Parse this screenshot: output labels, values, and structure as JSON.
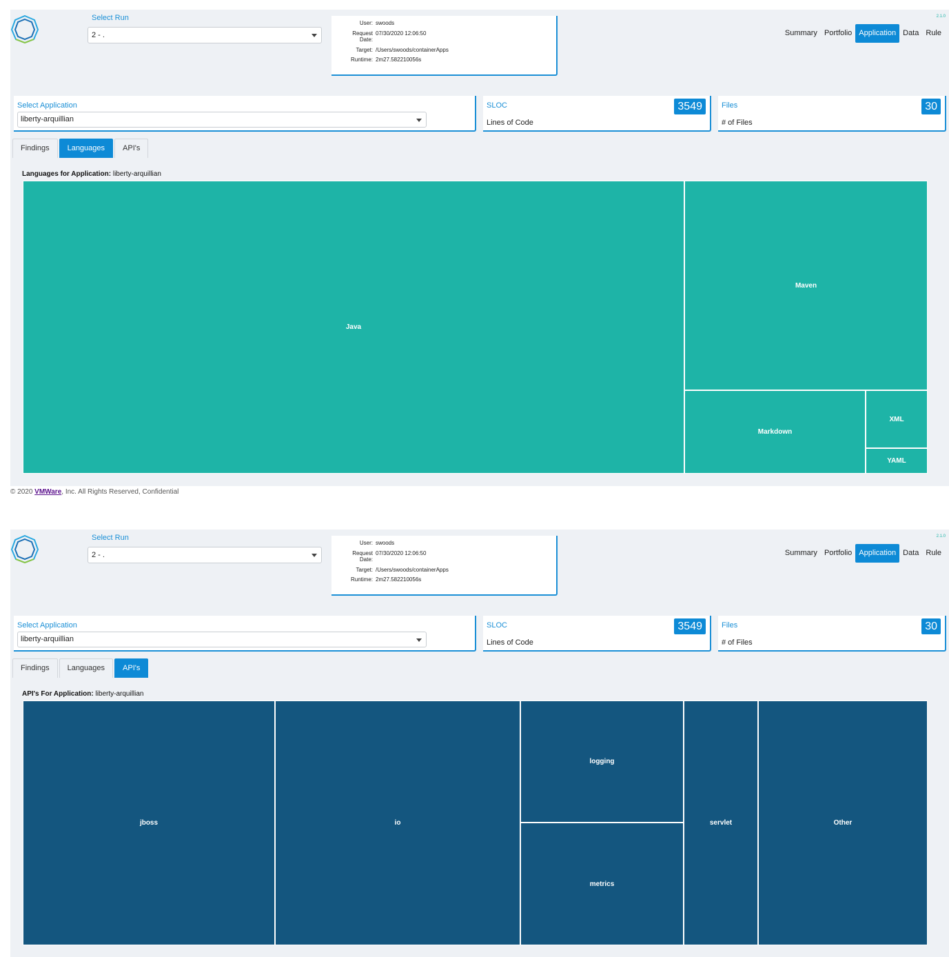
{
  "colors": {
    "accent": "#0d8ad6",
    "languages_fill": "#1eb4a7",
    "apis_fill": "#14567f"
  },
  "views": [
    {
      "header": {
        "select_run_label": "Select Run",
        "select_run_value": "2 - .",
        "run_info": {
          "user_label": "User:",
          "user_value": "swoods",
          "request_label": "Request",
          "date_label": "Date:",
          "request_date_value": "07/30/2020 12:06:50",
          "target_label": "Target:",
          "target_value": "/Users/swoods/containerApps",
          "runtime_label": "Runtime:",
          "runtime_value": "2m27.582210056s"
        },
        "version": "2.1.0",
        "nav": [
          "Summary",
          "Portfolio",
          "Application",
          "Data",
          "Rule"
        ],
        "nav_active": "Application"
      },
      "select_application": {
        "label": "Select Application",
        "value": "liberty-arquillian"
      },
      "sloc": {
        "title": "SLOC",
        "subtitle": "Lines of Code",
        "value": "3549"
      },
      "files": {
        "title": "Files",
        "subtitle": "# of Files",
        "value": "30"
      },
      "tabs": [
        "Findings",
        "Languages",
        "API's"
      ],
      "active_tab": "Languages",
      "chart_title_bold": "Languages for Application:",
      "chart_title_app": "liberty-arquillian",
      "chart_data": {
        "type": "treemap",
        "items": [
          {
            "label": "Java"
          },
          {
            "label": "Maven"
          },
          {
            "label": "Markdown"
          },
          {
            "label": "XML"
          },
          {
            "label": "YAML"
          }
        ]
      }
    },
    {
      "header": {
        "select_run_label": "Select Run",
        "select_run_value": "2 - .",
        "run_info": {
          "user_label": "User:",
          "user_value": "swoods",
          "request_label": "Request",
          "date_label": "Date:",
          "request_date_value": "07/30/2020 12:06:50",
          "target_label": "Target:",
          "target_value": "/Users/swoods/containerApps",
          "runtime_label": "Runtime:",
          "runtime_value": "2m27.582210056s"
        },
        "version": "2.1.0",
        "nav": [
          "Summary",
          "Portfolio",
          "Application",
          "Data",
          "Rule"
        ],
        "nav_active": "Application"
      },
      "select_application": {
        "label": "Select Application",
        "value": "liberty-arquillian"
      },
      "sloc": {
        "title": "SLOC",
        "subtitle": "Lines of Code",
        "value": "3549"
      },
      "files": {
        "title": "Files",
        "subtitle": "# of Files",
        "value": "30"
      },
      "tabs": [
        "Findings",
        "Languages",
        "API's"
      ],
      "active_tab": "API's",
      "chart_title_bold": "API's For Application:",
      "chart_title_app": "liberty-arquillian",
      "chart_data": {
        "type": "treemap",
        "items": [
          {
            "label": "jboss"
          },
          {
            "label": "io"
          },
          {
            "label": "logging"
          },
          {
            "label": "metrics"
          },
          {
            "label": "servlet"
          },
          {
            "label": "Other"
          }
        ]
      }
    }
  ],
  "footer": {
    "prefix": "© 2020 ",
    "link": "VMWare",
    "suffix": ", Inc. All Rights Reserved, Confidential"
  }
}
